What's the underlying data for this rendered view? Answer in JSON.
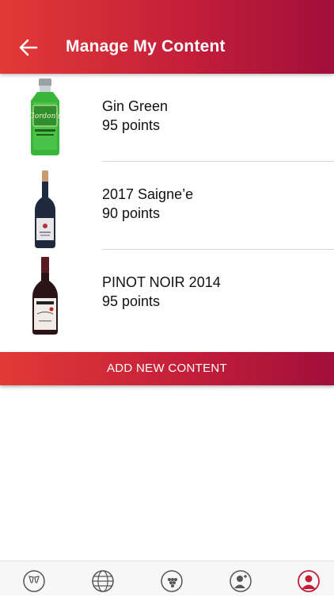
{
  "header": {
    "title": "Manage My Content",
    "back_icon": "arrow-left-icon"
  },
  "items": [
    {
      "name": "Gin Green",
      "points": "95 points",
      "image": "gin-bottle"
    },
    {
      "name": "2017 Saigne’e",
      "points": "90 points",
      "image": "white-wine-bottle"
    },
    {
      "name": "PINOT NOIR 2014",
      "points": "95 points",
      "image": "red-wine-bottle"
    }
  ],
  "add_button": {
    "label": "ADD NEW CONTENT"
  },
  "bottom_nav": {
    "items": [
      {
        "icon": "wine-glasses-icon",
        "active": false
      },
      {
        "icon": "globe-icon",
        "active": false
      },
      {
        "icon": "grapes-icon",
        "active": false
      },
      {
        "icon": "add-user-icon",
        "active": false
      },
      {
        "icon": "profile-icon",
        "active": true
      }
    ]
  },
  "colors": {
    "accent": "#c41f3a",
    "accent_dark": "#a10f3a",
    "accent_light": "#e23a36"
  }
}
